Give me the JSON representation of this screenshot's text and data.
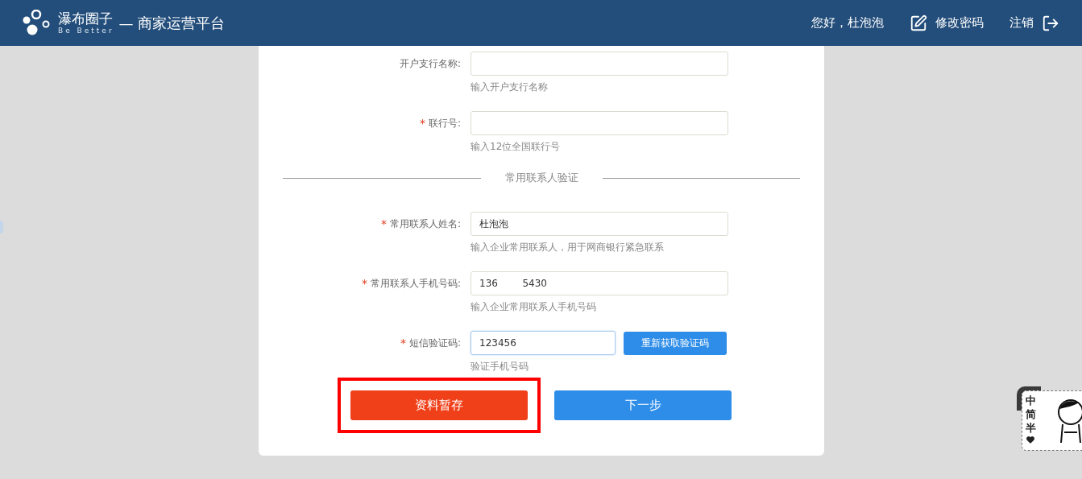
{
  "header": {
    "brand": "瀑布圈子",
    "slogan": "Be Better",
    "platform": "— 商家运营平台",
    "greeting": "您好，杜泡泡",
    "change_password": "修改密码",
    "logout": "注销"
  },
  "fields": [
    {
      "label": "开户支行名称:",
      "hint": "输入开户支行名称",
      "focused": false,
      "kind": "text"
    },
    {
      "label": "联行号:",
      "required_mark": "*",
      "hint": "输入12位全国联行号",
      "focused": false,
      "kind": "text"
    },
    {
      "kind": "divider",
      "label": "常用联系人验证"
    },
    {
      "label": "常用联系人姓名:",
      "required_mark": "*",
      "value": "杜泡泡",
      "hint": "输入企业常用联系人，用于网商银行紧急联系",
      "focused": false,
      "kind": "text"
    },
    {
      "label": "常用联系人手机号码:",
      "required_mark": "*",
      "value": "136        5430",
      "hint": "输入企业常用联系人手机号码",
      "focused": false,
      "kind": "text"
    },
    {
      "label": "短信验证码:",
      "required_mark": "*",
      "value": "123456",
      "hint": "验证手机号码",
      "focused": true,
      "kind": "code",
      "button": "重新获取验证码"
    }
  ],
  "actions": [
    {
      "label": "资料暂存",
      "kind": "save",
      "highlighted": true
    },
    {
      "label": "下一步",
      "kind": "next",
      "highlighted": false
    }
  ],
  "ime_widget": {
    "chars": [
      "中",
      "简",
      "半"
    ]
  }
}
